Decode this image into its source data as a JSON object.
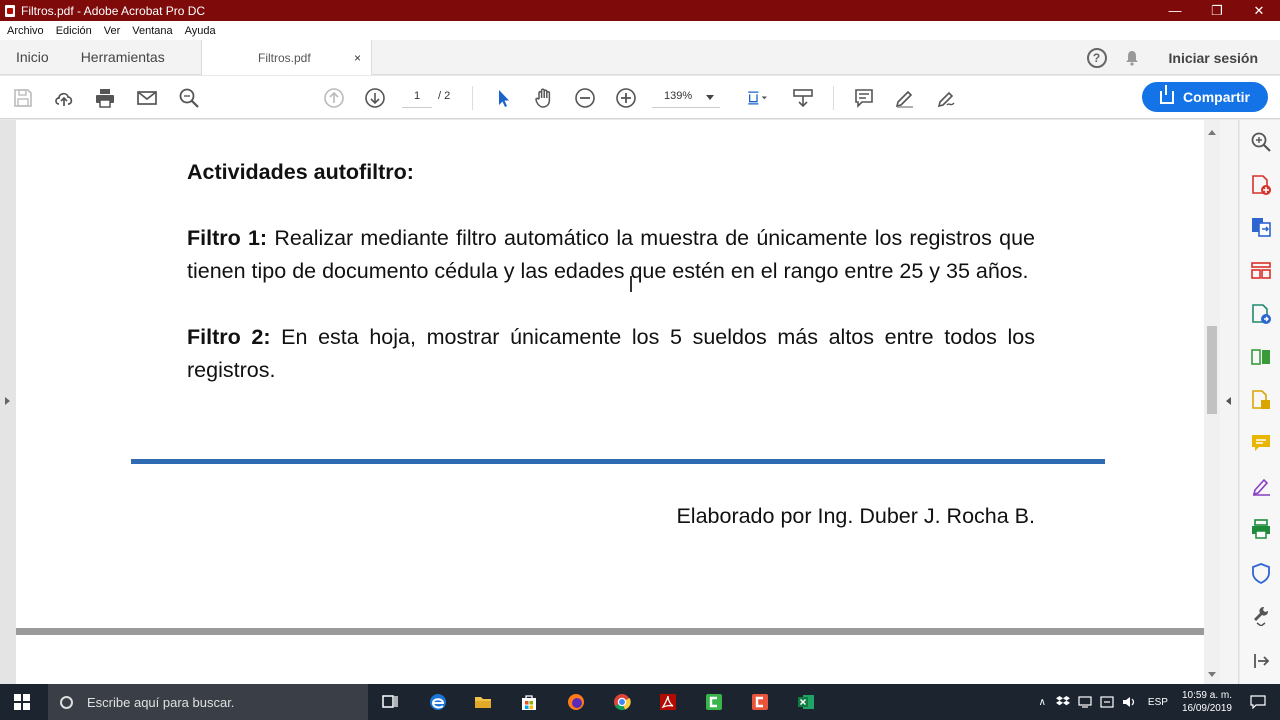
{
  "window": {
    "title": "Filtros.pdf - Adobe Acrobat Pro DC"
  },
  "menu": [
    "Archivo",
    "Edición",
    "Ver",
    "Ventana",
    "Ayuda"
  ],
  "tabs": {
    "home": "Inicio",
    "tools": "Herramientas",
    "document": "Filtros.pdf",
    "close": "×"
  },
  "header": {
    "signin": "Iniciar sesión",
    "help": "?"
  },
  "toolbar": {
    "page_current": "1",
    "page_total": "/ 2",
    "zoom": "139%",
    "share": "Compartir"
  },
  "document": {
    "heading": "Actividades autofiltro:",
    "filtro1_label": "Filtro 1:",
    "filtro1_text": " Realizar mediante filtro automático la muestra de únicamente los registros que tienen tipo de documento cédula y las edades que estén en el rango entre 25 y 35 años.",
    "filtro2_label": "Filtro 2:",
    "filtro2_text": " En esta hoja, mostrar únicamente los 5 sueldos más altos entre todos los registros.",
    "signature": "Elaborado por Ing. Duber J. Rocha B."
  },
  "taskbar": {
    "search_placeholder": "Escribe aquí para buscar.",
    "language": "ESP",
    "time": "10:59 a. m.",
    "date": "16/09/2019"
  },
  "colors": {
    "titlebar": "#7e0a0a",
    "accent": "#1473e6",
    "rule": "#2e6bb3"
  }
}
